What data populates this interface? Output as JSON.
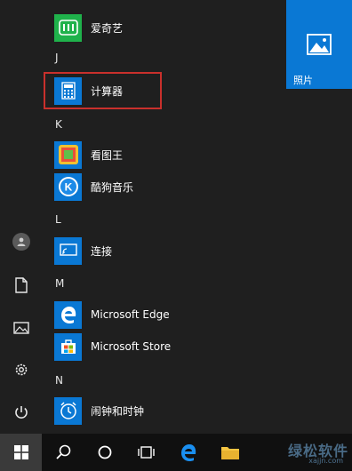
{
  "start_menu": {
    "sections": [
      {
        "letter": "",
        "apps": [
          {
            "label": "爱奇艺",
            "icon": "iqiyi-icon"
          }
        ]
      },
      {
        "letter": "J",
        "apps": [
          {
            "label": "计算器",
            "icon": "calculator-icon"
          }
        ]
      },
      {
        "letter": "K",
        "apps": [
          {
            "label": "看图王",
            "icon": "image-viewer-icon"
          },
          {
            "label": "酷狗音乐",
            "icon": "kugou-music-icon"
          }
        ]
      },
      {
        "letter": "L",
        "apps": [
          {
            "label": "连接",
            "icon": "connect-icon"
          }
        ]
      },
      {
        "letter": "M",
        "apps": [
          {
            "label": "Microsoft Edge",
            "icon": "edge-icon"
          },
          {
            "label": "Microsoft Store",
            "icon": "store-icon"
          }
        ]
      },
      {
        "letter": "N",
        "apps": [
          {
            "label": "闹钟和时钟",
            "icon": "alarm-clock-icon"
          }
        ]
      }
    ],
    "highlighted_app": "计算器"
  },
  "tiles": {
    "photos_label": "照片"
  },
  "watermark": {
    "text": "绿松软件",
    "sub": "xajjn.com"
  },
  "colors": {
    "accent": "#0a78d4",
    "highlight_border": "#c9302c",
    "background": "#1f1f1f"
  }
}
